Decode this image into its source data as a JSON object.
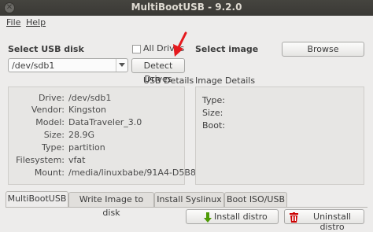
{
  "window": {
    "title": "MultiBootUSB - 9.2.0"
  },
  "menu": {
    "file": "File",
    "help": "Help"
  },
  "usb": {
    "section_label": "Select USB disk",
    "selected_disk": "/dev/sdb1",
    "all_drives_label": "All Drives",
    "all_drives_checked": false,
    "detect_button": "Detect Drives",
    "details_title": "USB Details",
    "details": [
      {
        "label": "Drive:",
        "value": "/dev/sdb1"
      },
      {
        "label": "Vendor:",
        "value": "Kingston"
      },
      {
        "label": "Model:",
        "value": "DataTraveler_3.0"
      },
      {
        "label": "Size:",
        "value": "28.9G"
      },
      {
        "label": "Type:",
        "value": "partition"
      },
      {
        "label": "Filesystem:",
        "value": "vfat"
      },
      {
        "label": "Mount:",
        "value": "/media/linuxbabe/91A4-D5B8"
      }
    ]
  },
  "image": {
    "section_label": "Select image",
    "browse_button": "Browse",
    "details_title": "Image Details",
    "details": [
      {
        "label": "Type:"
      },
      {
        "label": "Size:"
      },
      {
        "label": "Boot:"
      }
    ]
  },
  "tabs": [
    {
      "label": "MultiBootUSB",
      "active": true
    },
    {
      "label": "Write Image to disk",
      "active": false
    },
    {
      "label": "Install Syslinux",
      "active": false
    },
    {
      "label": "Boot ISO/USB",
      "active": false
    }
  ],
  "actions": {
    "install_label": "Install distro",
    "uninstall_label": "Uninstall distro"
  },
  "colors": {
    "titlebar": "#3c3b37",
    "annotation_arrow": "#e5191d",
    "install_icon": "#4e9a06",
    "uninstall_icon": "#cc0000"
  }
}
